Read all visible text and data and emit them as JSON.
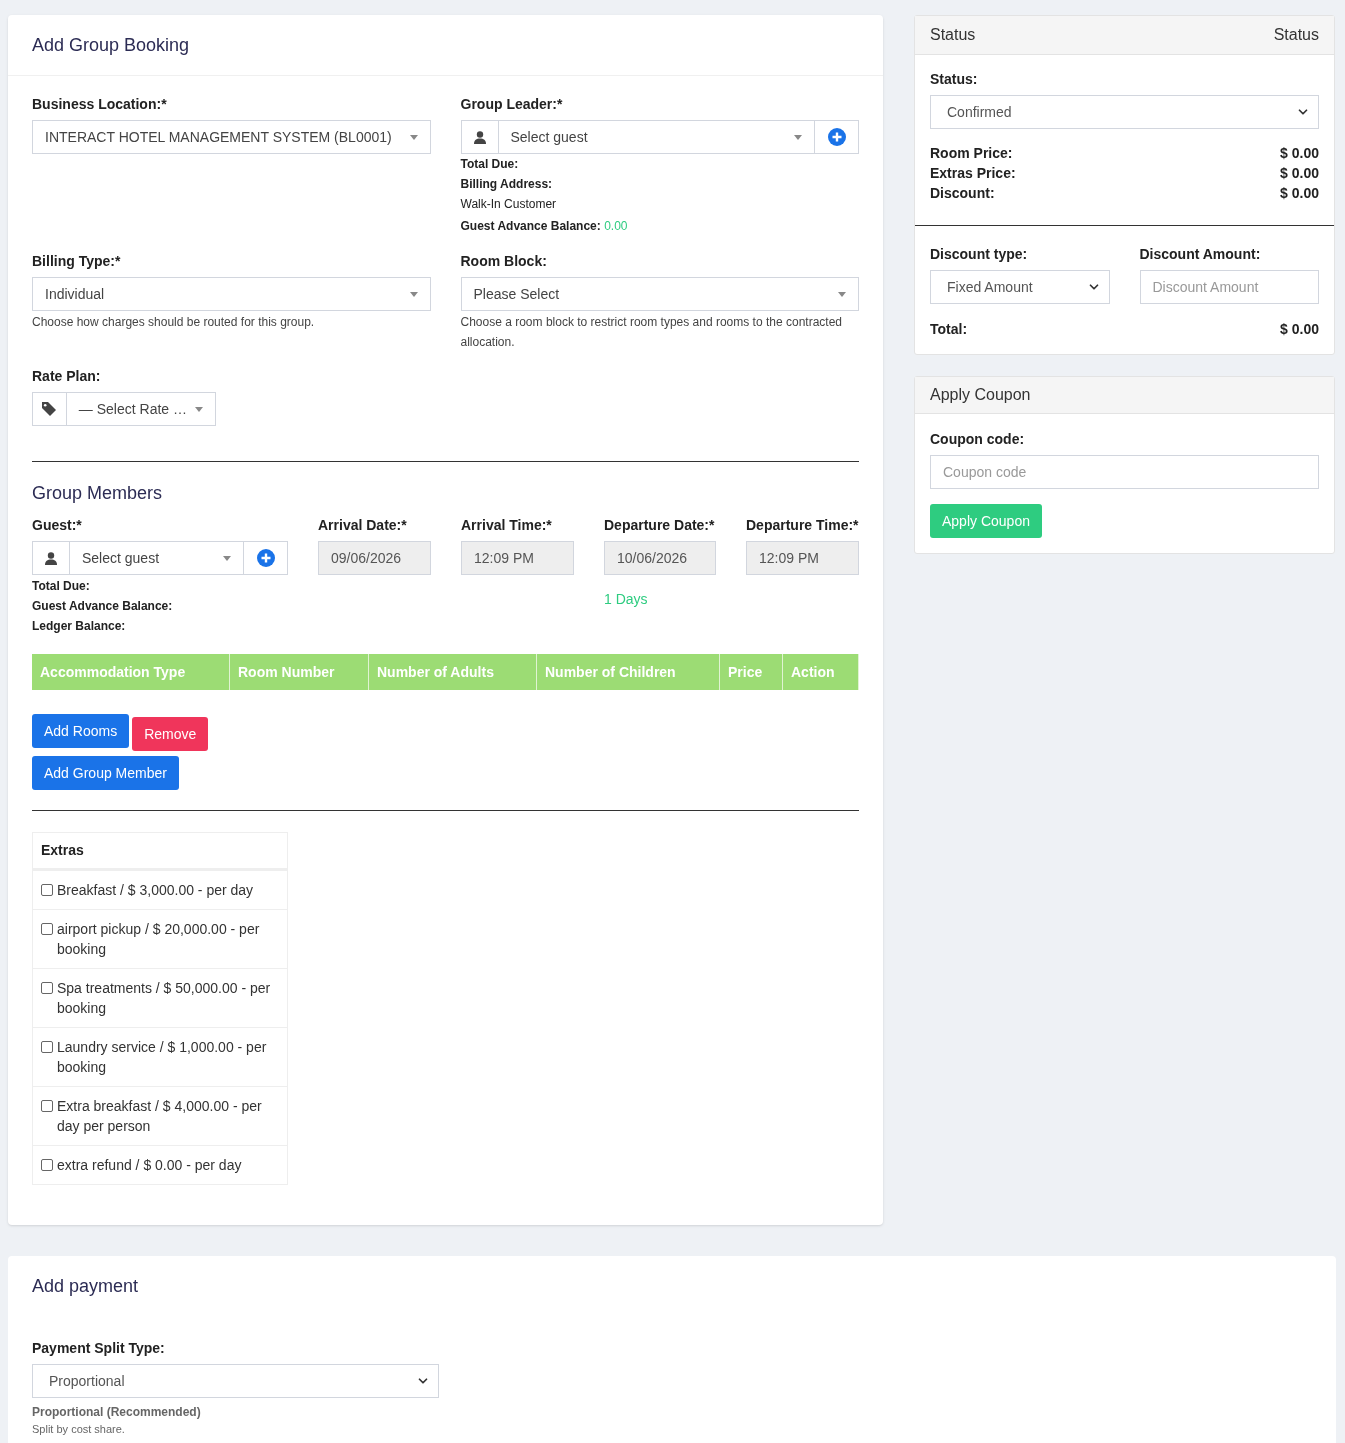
{
  "booking": {
    "title": "Add Group Booking",
    "business_location": {
      "label": "Business Location:*",
      "value": "INTERACT HOTEL MANAGEMENT SYSTEM (BL0001)"
    },
    "group_leader": {
      "label": "Group Leader:*",
      "value": "Select guest",
      "total_due_label": "Total Due:",
      "billing_address_label": "Billing Address:",
      "billing_address": "Walk-In Customer",
      "advance_label": "Guest Advance Balance:",
      "advance_value": "0.00"
    },
    "billing_type": {
      "label": "Billing Type:*",
      "value": "Individual",
      "help": "Choose how charges should be routed for this group."
    },
    "room_block": {
      "label": "Room Block:",
      "value": "Please Select",
      "help": "Choose a room block to restrict room types and rooms to the contracted allocation."
    },
    "rate_plan": {
      "label": "Rate Plan:",
      "value": "— Select Rate …"
    },
    "members": {
      "title": "Group Members",
      "guest": {
        "label": "Guest:*",
        "value": "Select guest",
        "info": [
          "Total Due:",
          "Guest Advance Balance:",
          "Ledger Balance:"
        ]
      },
      "dates": [
        {
          "label": "Arrival Date:*",
          "value": "09/06/2026"
        },
        {
          "label": "Arrival Time:*",
          "value": "12:09 PM"
        },
        {
          "label": "Departure Date:*",
          "value": "10/06/2026"
        },
        {
          "label": "Departure Time:*",
          "value": "12:09 PM"
        }
      ],
      "nights": "1 Days",
      "table": {
        "columns": [
          "Accommodation Type",
          "Room Number",
          "Number of Adults",
          "Number of Children",
          "Price",
          "Action"
        ]
      },
      "buttons": [
        {
          "label": "Add Rooms",
          "kind": "primary"
        },
        {
          "label": "Remove",
          "kind": "danger"
        }
      ],
      "add_member": "Add Group Member"
    },
    "extras": {
      "title": "Extras",
      "items": [
        {
          "label": "Breakfast / $ 3,000.00 - per day",
          "checked": false
        },
        {
          "label": "airport pickup / $ 20,000.00 - per booking",
          "checked": false
        },
        {
          "label": "Spa treatments / $ 50,000.00 - per booking",
          "checked": false
        },
        {
          "label": "Laundry service / $ 1,000.00 - per booking",
          "checked": false
        },
        {
          "label": "Extra breakfast / $ 4,000.00 - per day per person",
          "checked": false
        },
        {
          "label": "extra refund / $ 0.00 - per day",
          "checked": false
        }
      ]
    }
  },
  "status_card": {
    "title": "Status",
    "title_right": "Status",
    "status_label": "Status:",
    "status_value": "Confirmed",
    "prices": [
      {
        "label": "Room Price:",
        "value": "$ 0.00"
      },
      {
        "label": "Extras Price:",
        "value": "$ 0.00"
      },
      {
        "label": "Discount:",
        "value": "$ 0.00"
      }
    ],
    "discount_type": {
      "label": "Discount type:",
      "value": "Fixed Amount"
    },
    "discount_amount": {
      "label": "Discount Amount:",
      "placeholder": "Discount Amount"
    },
    "total": {
      "label": "Total:",
      "value": "$ 0.00"
    }
  },
  "coupon_card": {
    "title": "Apply Coupon",
    "label": "Coupon code:",
    "placeholder": "Coupon code",
    "button": "Apply Coupon"
  },
  "payment": {
    "title": "Add payment",
    "label": "Payment Split Type:",
    "value": "Proportional",
    "help_title": "Proportional (Recommended)",
    "help": "Split by cost share."
  }
}
